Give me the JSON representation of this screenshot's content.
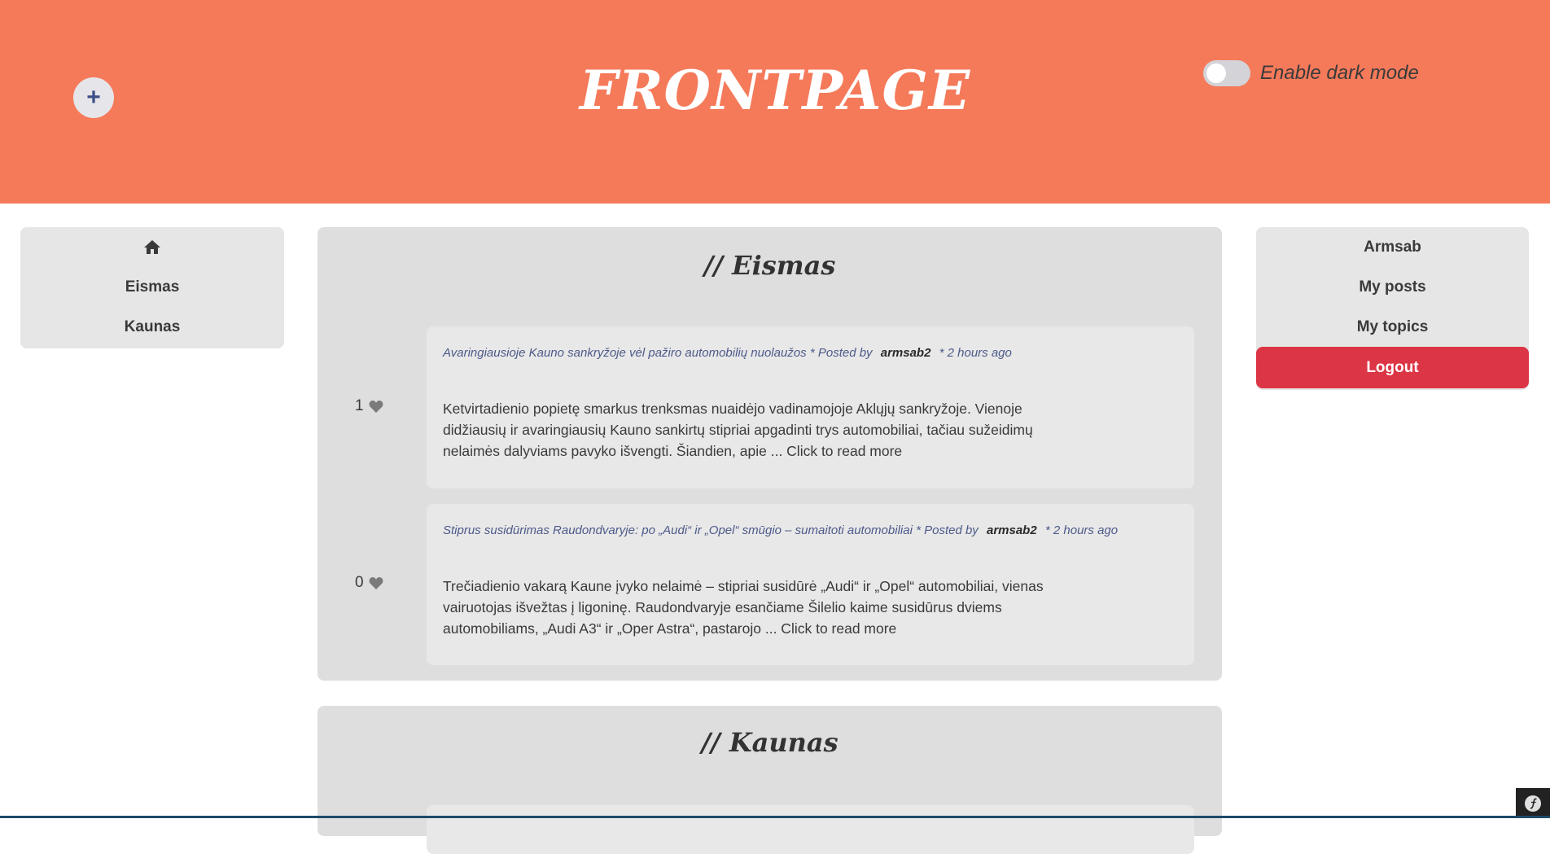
{
  "header": {
    "title": "FRONTPAGE",
    "add_button": "+",
    "dark_mode_label": "Enable dark mode",
    "dark_mode_enabled": false,
    "background": "#f57a5a"
  },
  "left_nav": {
    "home_icon": "home-icon",
    "items": [
      "Eismas",
      "Kaunas"
    ]
  },
  "right_nav": {
    "username": "Armsab",
    "my_posts": "My posts",
    "my_topics": "My topics",
    "logout": "Logout",
    "logout_color": "#dc3545"
  },
  "topics": [
    {
      "title": "// Eismas",
      "posts": [
        {
          "likes": "1",
          "title": "Avaringiausioje Kauno sankryžoje vėl pažiro automobilių nuolaužos",
          "posted_by_prefix": "* Posted by",
          "author": "armsab2",
          "time": "* 2 hours ago",
          "excerpt": "Ketvirtadienio popietę smarkus trenksmas nuaidėjo vadinamojoje Aklųjų sankryžoje. Vienoje didžiausių ir avaringiausių Kauno sankirtų stipriai apgadinti trys automobiliai, tačiau sužeidimų nelaimės dalyviams pavyko išvengti. Šiandien, apie ... Click to read more"
        },
        {
          "likes": "0",
          "title": "Stiprus susidūrimas Raudondvaryje: po „Audi“ ir „Opel“ smūgio – sumaitoti automobiliai",
          "posted_by_prefix": "* Posted by",
          "author": "armsab2",
          "time": "* 2 hours ago",
          "excerpt": "Trečiadienio vakarą Kaune įvyko nelaimė – stipriai susidūrė „Audi“ ir „Opel“ automobiliai, vienas vairuotojas išvežtas į ligoninę. Raudondvaryje esančiame Šilelio kaime susidūrus dviems automobiliams, „Audi A3“ ir „Oper Astra“, pastarojo ... Click to read more"
        }
      ]
    },
    {
      "title": "// Kaunas",
      "posts": []
    }
  ]
}
